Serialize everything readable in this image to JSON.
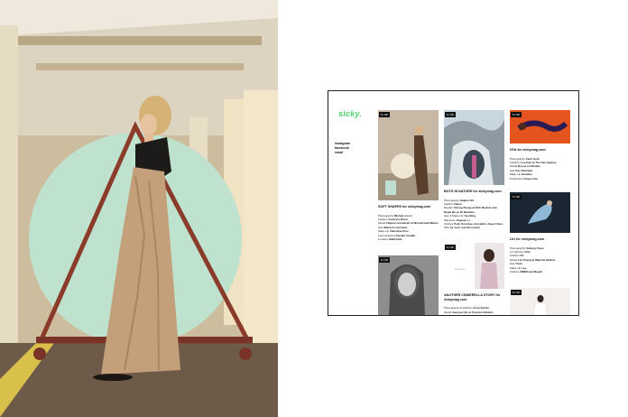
{
  "site": {
    "logo": "sicky.",
    "social": [
      "instagram",
      "facebook",
      "email"
    ],
    "colors": {
      "logo_green": "#4fd36a",
      "text": "#111111",
      "frame": "#222222"
    }
  },
  "left_photo": {
    "description_icon": "photo-fashion-model-triangle"
  },
  "cards": [
    {
      "count": "1 / 10",
      "title": "SOFT SHAPES for sickymag.com",
      "credits": [
        {
          "k": "Photography",
          "v": "Michele Losci"
        },
        {
          "k": "Fashion",
          "v": "Federica Rossi"
        },
        {
          "k": "Model",
          "v": "Filippa Lunnebratt at Wonderwall Milano"
        },
        {
          "k": "Hair",
          "v": "Mauricio Hormaza"
        },
        {
          "k": "Make-Up",
          "v": "Valentina Pino"
        },
        {
          "k": "Light Assistant",
          "v": "Davide Cardini"
        },
        {
          "k": "Location",
          "v": "B&B Italia"
        }
      ]
    },
    {
      "count": "1 / 10",
      "title": "BOYS IN NATURE for sickymag.com",
      "credits": [
        {
          "k": "Photography",
          "v": "Haijian Shi"
        },
        {
          "k": "Fashion",
          "v": "Ripex"
        },
        {
          "k": "Models",
          "v": "Yidong Zhang at DVC Models and Ruijie Bu at JS Newface"
        },
        {
          "k": "Hair & Make-Up",
          "v": "Yao Bing"
        },
        {
          "k": "Manicure",
          "v": "Jingwen Li"
        },
        {
          "k": "Clothes",
          "v": "Potk, Dominey, Amsakthi, Angel Chen, Yu's by Yesir and Absorismi"
        }
      ]
    },
    {
      "count": "1 / 10",
      "title": "NYA for sickymag.com",
      "credits": [
        {
          "k": "Photography",
          "v": "Zach Gold"
        },
        {
          "k": "Fashion",
          "v": "Lisa Kan at The Rex Agency"
        },
        {
          "k": "Model",
          "v": "Nya at LA Models"
        },
        {
          "k": "Hair",
          "v": "Kaz Shimada"
        },
        {
          "k": "Make-Up",
          "v": "Hamako"
        },
        {
          "k": "Production",
          "v": "Flower Ave"
        }
      ]
    },
    {
      "count": "1 / 10",
      "title": "LIU for sickymag.com",
      "credits": [
        {
          "k": "Photography",
          "v": "Sinlang Chow"
        },
        {
          "k": "Art Direction",
          "v": "Kilo"
        },
        {
          "k": "Fashion",
          "v": "RJ"
        },
        {
          "k": "Model",
          "v": "Liu Chang at Wanzhe Models"
        },
        {
          "k": "Hair",
          "v": "Yiwei"
        },
        {
          "k": "Make-Up",
          "v": "Lea"
        },
        {
          "k": "Clothes",
          "v": "XIMMI and Mayall"
        }
      ]
    },
    {
      "count": "1 / 10",
      "title": "ANOTHER CINDERELLA STORY for sickymag.com",
      "credits": [
        {
          "k": "Photography & Fashion",
          "v": "Anna Sandri"
        },
        {
          "k": "Model",
          "v": "Xiaoyue Qin at Freedom Models"
        }
      ]
    },
    {
      "count": "1 / 10"
    },
    {
      "count": "1 / 10"
    }
  ]
}
